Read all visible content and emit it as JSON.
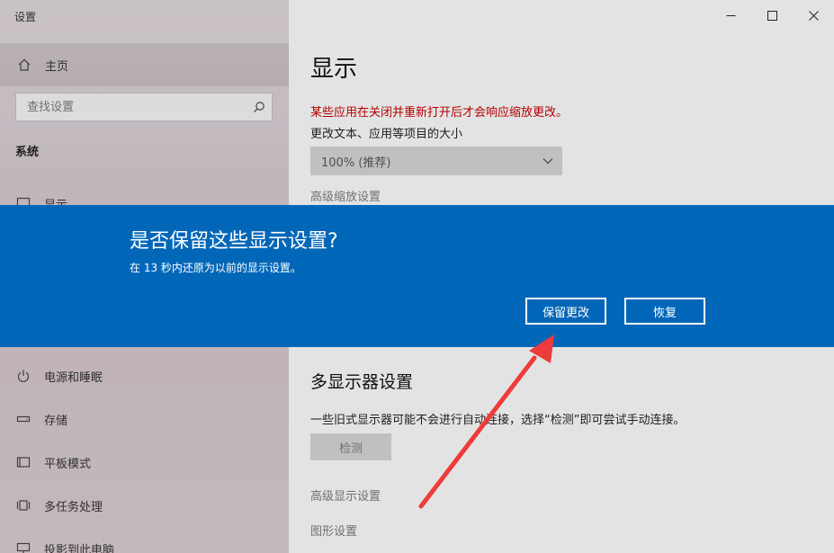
{
  "window": {
    "title": "设置"
  },
  "sidebar": {
    "home_label": "主页",
    "search_placeholder": "查找设置",
    "section_title": "系统",
    "items": [
      {
        "label": "显示",
        "icon": "monitor-icon"
      },
      {
        "label": "电源和睡眠",
        "icon": "power-icon"
      },
      {
        "label": "存储",
        "icon": "storage-icon"
      },
      {
        "label": "平板模式",
        "icon": "tablet-icon"
      },
      {
        "label": "多任务处理",
        "icon": "multitask-icon"
      },
      {
        "label": "投影到此电脑",
        "icon": "project-icon"
      }
    ]
  },
  "main": {
    "page_title": "显示",
    "warning_text": "某些应用在关闭并重新打开后才会响应缩放更改。",
    "size_label": "更改文本、应用等项目的大小",
    "scale_value": "100% (推荐)",
    "advanced_scaling_link": "高级缩放设置",
    "multi_display_title": "多显示器设置",
    "multi_display_desc": "一些旧式显示器可能不会进行自动连接，选择“检测”即可尝试手动连接。",
    "detect_button": "检测",
    "advanced_display_link": "高级显示设置",
    "graphics_link": "图形设置"
  },
  "dialog": {
    "title": "是否保留这些显示设置?",
    "message": "在 13 秒内还原为以前的显示设置。",
    "keep_button": "保留更改",
    "revert_button": "恢复"
  },
  "colors": {
    "dialog_bg": "#0067b8",
    "warning": "#c00000",
    "arrow": "#ee3b3b"
  }
}
